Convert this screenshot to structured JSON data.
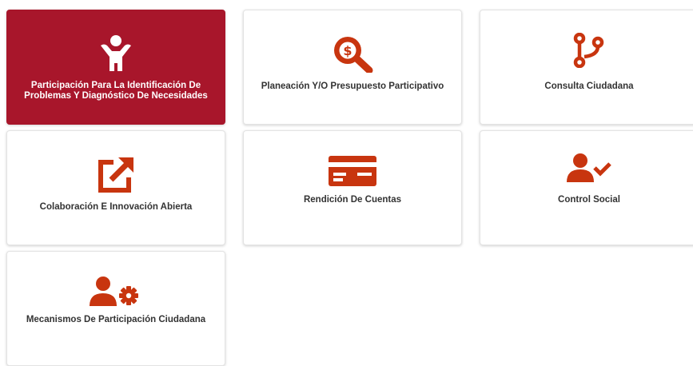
{
  "colors": {
    "accent": "#a8162b",
    "icon": "#c8350f",
    "text": "#333333",
    "active_text": "#ffffff"
  },
  "cards": [
    {
      "label": "Participación Para La Identificación De Problemas Y Diagnóstico De Necesidades",
      "icon": "child-icon",
      "active": true
    },
    {
      "label": "Planeación Y/O Presupuesto Participativo",
      "icon": "dollar-search-icon",
      "active": false
    },
    {
      "label": "Consulta Ciudadana",
      "icon": "branch-icon",
      "active": false
    },
    {
      "label": "Colaboración E Innovación Abierta",
      "icon": "external-link-icon",
      "active": false
    },
    {
      "label": "Rendición De Cuentas",
      "icon": "credit-card-icon",
      "active": false
    },
    {
      "label": "Control Social",
      "icon": "user-check-icon",
      "active": false
    },
    {
      "label": "Mecanismos De Participación Ciudadana",
      "icon": "user-gear-icon",
      "active": false
    }
  ]
}
